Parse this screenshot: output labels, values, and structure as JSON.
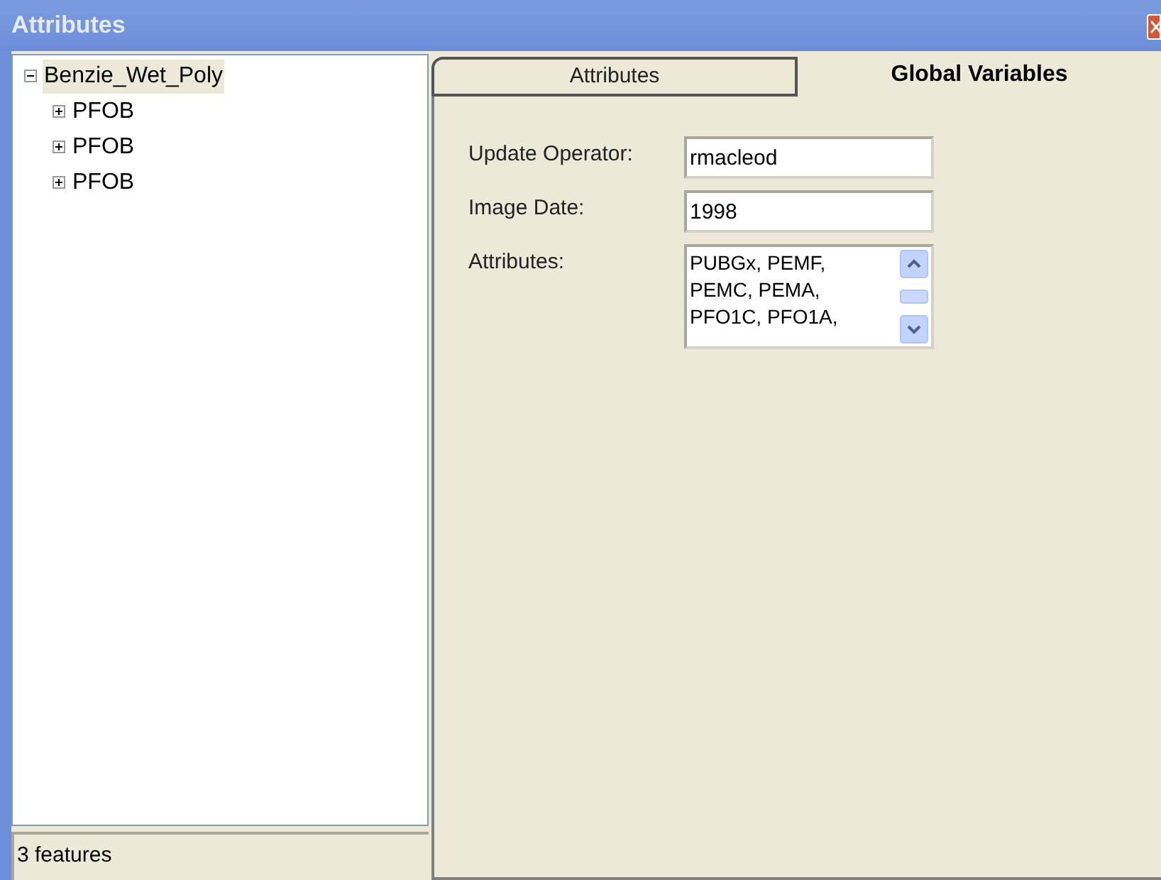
{
  "window": {
    "title": "Attributes"
  },
  "tree": [
    {
      "label": "Benzie_Wet_Poly",
      "expanded": true,
      "selected": true,
      "children": [
        {
          "label": "PFOB",
          "expanded": false,
          "selected": false
        },
        {
          "label": "PFOB",
          "expanded": false,
          "selected": false
        },
        {
          "label": "PFOB",
          "expanded": false,
          "selected": false
        }
      ]
    }
  ],
  "status_bar": "3 features",
  "tabs": [
    {
      "label": "Attributes",
      "selected": false
    },
    {
      "label": "Global Variables",
      "selected": true
    }
  ],
  "fields": [
    {
      "label": "Update Operator:",
      "value": "rmacleod",
      "kind": "text"
    },
    {
      "label": "Image Date:",
      "value": "1998",
      "kind": "text"
    },
    {
      "label": "Attributes:",
      "kind": "list",
      "lines": [
        "PUBGx, PEMF,",
        "PEMC, PEMA,",
        "PFO1C, PFO1A,"
      ]
    }
  ]
}
